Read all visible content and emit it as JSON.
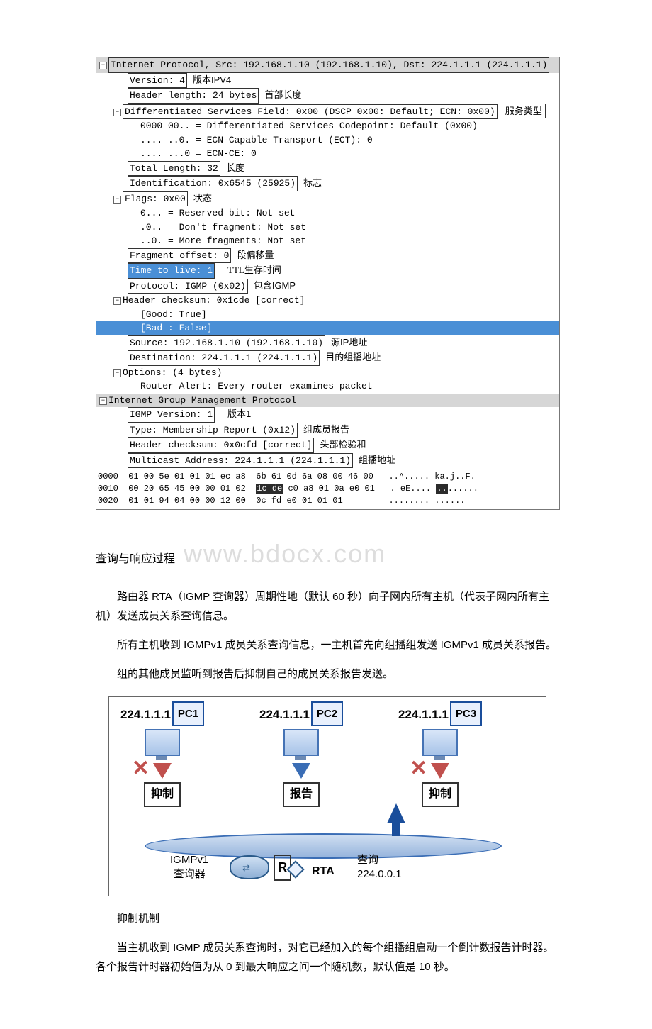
{
  "packet": {
    "ip_header_line": "Internet Protocol, Src: 192.168.1.10 (192.168.1.10), Dst: 224.1.1.1 (224.1.1.1)",
    "version": "Version: 4",
    "version_cn": "版本IPV4",
    "hlen": "Header length: 24 bytes",
    "hlen_cn": "首部长度",
    "dsf": "Differentiated Services Field: 0x00 (DSCP 0x00: Default; ECN: 0x00)",
    "dsf_cn": "服务类型",
    "dscp": "0000 00.. = Differentiated Services Codepoint: Default (0x00)",
    "ect": ".... ..0. = ECN-Capable Transport (ECT): 0",
    "ecn": ".... ...0 = ECN-CE: 0",
    "tlen": "Total Length: 32",
    "tlen_cn": "长度",
    "id": "Identification: 0x6545 (25925)",
    "id_cn": "标志",
    "flags": "Flags: 0x00",
    "flags_cn": "状态",
    "f0": "0... = Reserved bit: Not set",
    "f1": ".0.. = Don't fragment: Not set",
    "f2": "..0. = More fragments: Not set",
    "frag": "Fragment offset: 0",
    "frag_cn": "段偏移量",
    "ttl": "Time to live: 1",
    "ttl_cn": "TTL生存时间",
    "proto": "Protocol: IGMP (0x02)",
    "proto_cn": "包含IGMP",
    "cksum": "Header checksum: 0x1cde [correct]",
    "good": "[Good: True]",
    "bad": "[Bad : False]",
    "src": "Source: 192.168.1.10 (192.168.1.10)",
    "src_cn": "源IP地址",
    "dst": "Destination: 224.1.1.1 (224.1.1.1)",
    "dst_cn": "目的组播地址",
    "opt": "Options: (4 bytes)",
    "ra": "Router Alert: Every router examines packet",
    "igmp_hdr": "Internet Group Management Protocol",
    "igmp_ver": "IGMP Version: 1",
    "igmp_ver_cn": "版本1",
    "igmp_type": "Type: Membership Report (0x12)",
    "igmp_type_cn": "组成员报告",
    "igmp_cksum": "Header checksum: 0x0cfd [correct]",
    "igmp_cksum_cn": "头部检验和",
    "igmp_addr": "Multicast Address: 224.1.1.1 (224.1.1.1)",
    "igmp_addr_cn": "组播地址"
  },
  "hex": {
    "l0a": "0000  01 00 5e 01 01 01 ec a8  6b 61 0d 6a 08 00 46 00   ..^..... ka.j..F.",
    "l1a": "0010  00 20 65 45 00 00 01 02  ",
    "l1b": "1c de",
    "l1c": " c0 a8 01 0a e0 01   . eE.... ",
    "l1d": "..",
    "l1e": "......",
    "l2a": "0020  01 01 94 04 00 00 12 00  0c fd e0 01 01 01         ........ ......"
  },
  "text": {
    "watermark_cn": "查询与响应过程",
    "watermark_en": "www.bdocx.com",
    "p1": "路由器 RTA（IGMP 查询器）周期性地（默认 60 秒）向子网内所有主机（代表子网内所有主机）发送成员关系查询信息。",
    "p2": "所有主机收到 IGMPv1 成员关系查询信息，一主机首先向组播组发送 IGMPv1 成员关系报告。",
    "p3": "组的其他成员监听到报告后抑制自己的成员关系报告发送。",
    "p4": "抑制机制",
    "p5": "当主机收到 IGMP 成员关系查询时，对它已经加入的每个组播组启动一个倒计数报告计时器。各个报告计时器初始值为从 0 到最大响应之间一个随机数，默认值是 10 秒。"
  },
  "diagram": {
    "ip": "224.1.1.1",
    "pc1": "PC1",
    "pc2": "PC2",
    "pc3": "PC3",
    "suppress": "抑制",
    "report": "报告",
    "igmp_lbl1": "IGMPv1",
    "igmp_lbl2": "查询器",
    "router_r": "R",
    "rta": "RTA",
    "query": "查询",
    "query_ip": "224.0.0.1"
  }
}
